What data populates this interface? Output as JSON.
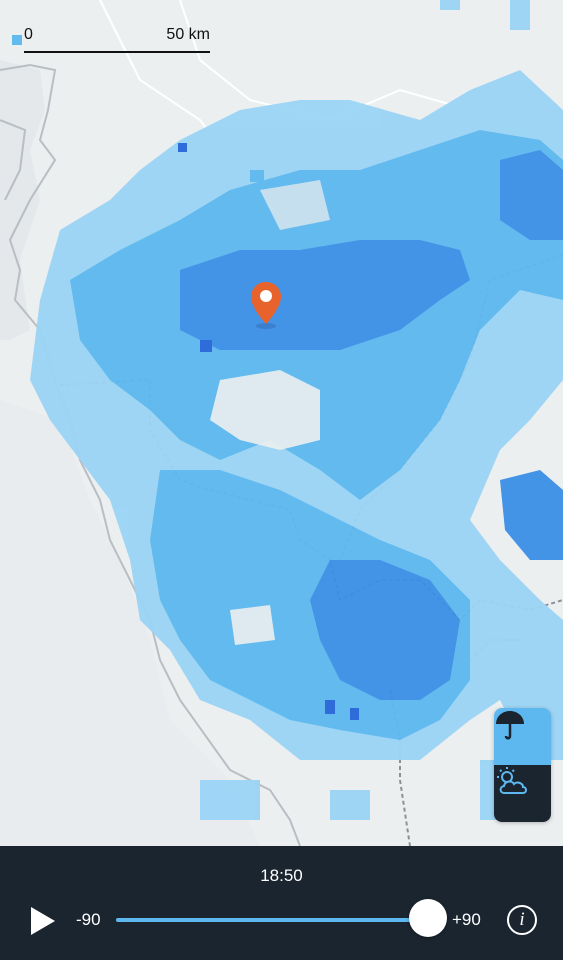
{
  "map": {
    "scale": {
      "start_label": "0",
      "end_label": "50 km"
    },
    "pin_color": "#e8622c",
    "precip_colors": {
      "light": "#9bd4f5",
      "moderate": "#5cb8ef",
      "heavy": "#3a8fe6",
      "intense": "#2365d8"
    }
  },
  "layers": {
    "rain_icon": "umbrella-icon",
    "sky_icon": "partly-cloudy-icon"
  },
  "player": {
    "time": "18:50",
    "min_label": "-90",
    "max_label": "+90",
    "position": 1.0,
    "play_icon": "play-icon",
    "info_icon": "info-icon"
  },
  "colors": {
    "accent": "#5cb8ef",
    "panel": "#1b2530"
  }
}
